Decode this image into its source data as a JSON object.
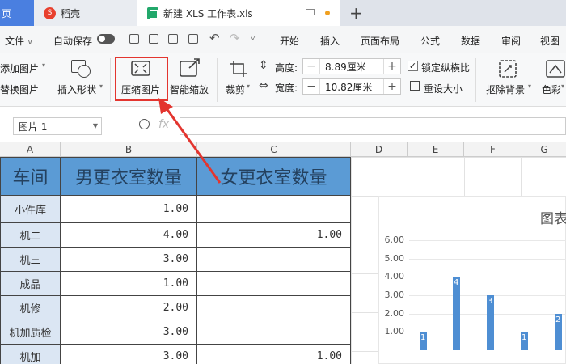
{
  "tabs": {
    "home": "页",
    "docer": "稻壳",
    "file": "新建 XLS 工作表.xls",
    "add": "+"
  },
  "menubar": {
    "file": "文件",
    "autosave": "自动保存",
    "items": [
      "开始",
      "插入",
      "页面布局",
      "公式",
      "数据",
      "审阅",
      "视图"
    ]
  },
  "ribbon": {
    "add_image": "添加图片",
    "replace_image": "替换图片",
    "insert_shape": "插入形状",
    "compress": "压缩图片",
    "smart_zoom": "智能缩放",
    "crop": "裁剪",
    "height_label": "高度:",
    "height_value": "8.89厘米",
    "width_label": "宽度:",
    "width_value": "10.82厘米",
    "lock_ratio": "锁定纵横比",
    "reset_size": "重设大小",
    "remove_bg": "抠除背景",
    "color": "色彩"
  },
  "formula": {
    "name_box": "图片 1",
    "fx": "fx"
  },
  "columns": [
    "A",
    "B",
    "C",
    "D",
    "E",
    "F",
    "G"
  ],
  "table": {
    "headers": [
      "车间",
      "男更衣室数量",
      "女更衣室数量"
    ],
    "rows": [
      [
        "小件库",
        "1.00",
        ""
      ],
      [
        "机二",
        "4.00",
        "1.00"
      ],
      [
        "机三",
        "3.00",
        ""
      ],
      [
        "成品",
        "1.00",
        ""
      ],
      [
        "机修",
        "2.00",
        ""
      ],
      [
        "机加质检",
        "3.00",
        ""
      ],
      [
        "机加",
        "3.00",
        "1.00"
      ]
    ]
  },
  "chart_data": {
    "type": "bar",
    "title": "图表",
    "ylim": [
      0,
      6
    ],
    "yticks": [
      "6.00",
      "5.00",
      "4.00",
      "3.00",
      "2.00",
      "1.00"
    ],
    "series": [
      {
        "values": [
          1,
          4,
          3,
          1,
          2
        ]
      }
    ],
    "bar_color": "#4e8ed3"
  },
  "colors": {
    "accent": "#4a7fe0",
    "header_fill": "#5b9bd5",
    "first_col_fill": "#dbe6f3",
    "highlight": "#e3352f"
  }
}
